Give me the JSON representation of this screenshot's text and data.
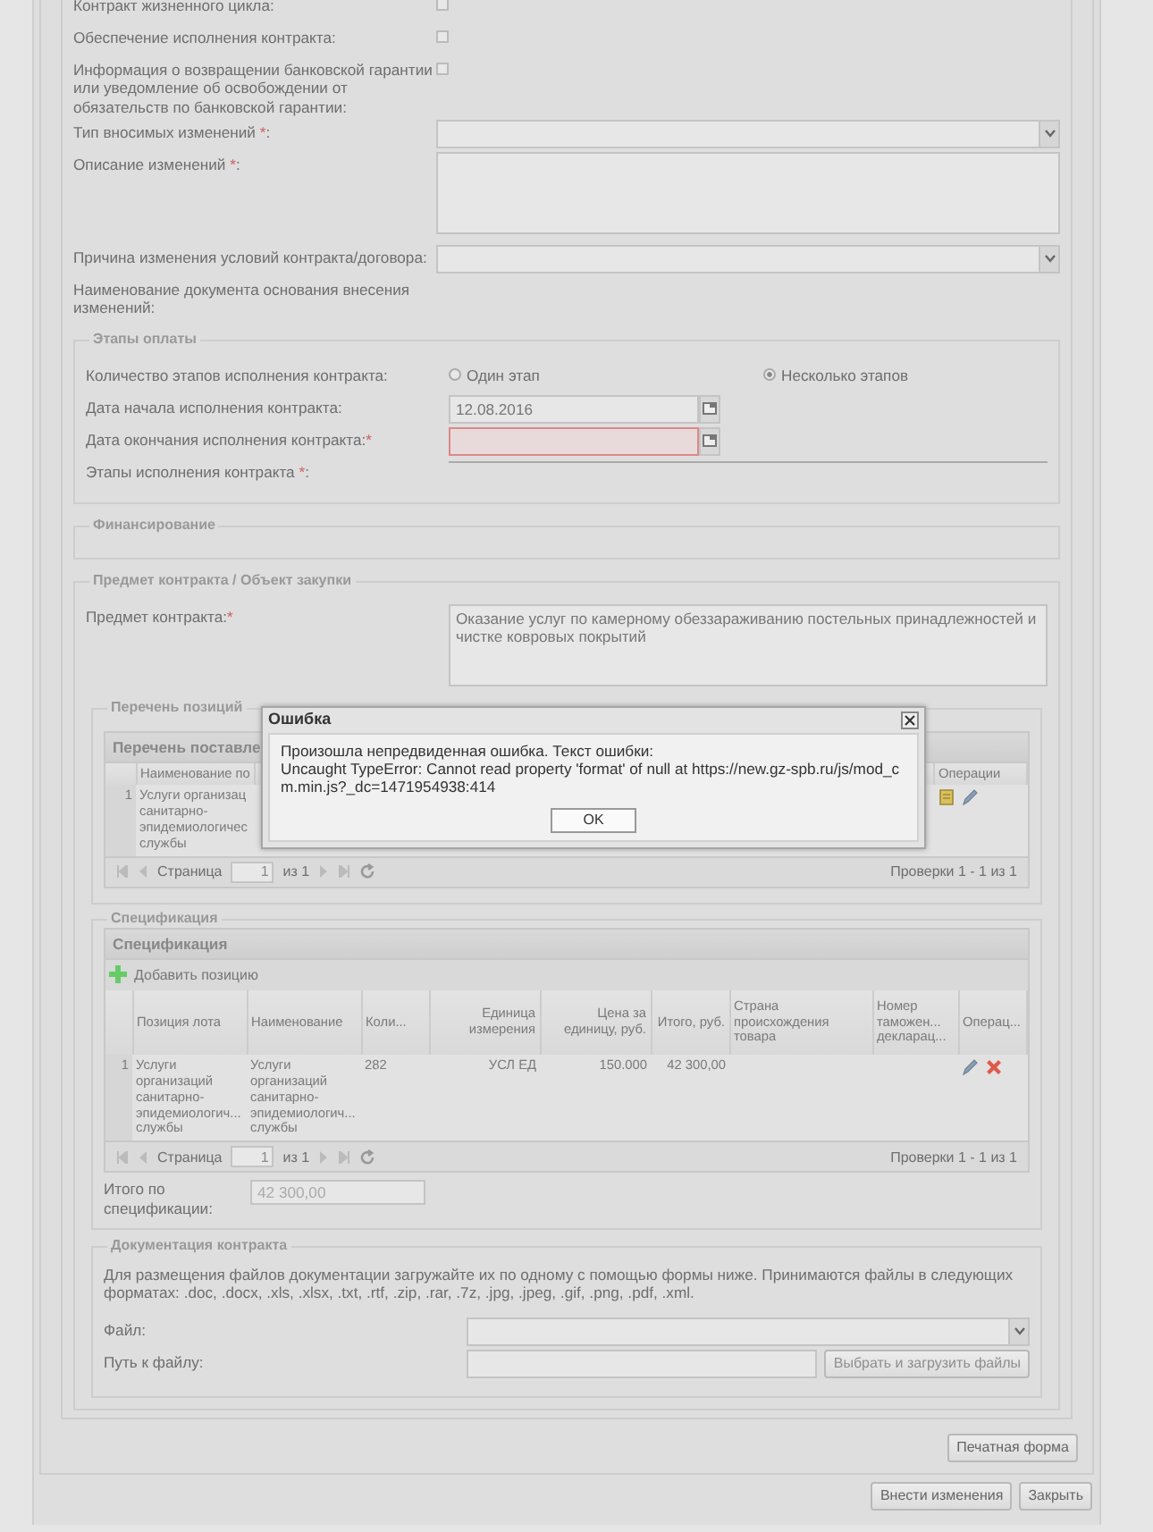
{
  "fields": [
    {
      "kind": "checkbox",
      "label": "Контракт жизненного цикла:",
      "checked": false
    },
    {
      "kind": "checkbox",
      "label": "Обеспечение исполнения контракта:",
      "checked": false
    },
    {
      "kind": "checkbox",
      "label": "Информация о возвращении банковской гарантии или уведомление об освобождении от обязательств по банковской гарантии:",
      "checked": false
    },
    {
      "kind": "select",
      "label": "Тип вносимых изменений ",
      "required_mark": "*",
      "label_end": ":"
    },
    {
      "kind": "textarea",
      "label": "Описание изменений ",
      "required_mark": "*",
      "label_end": ":"
    },
    {
      "kind": "select",
      "label": "Причина изменения условий контракта/договора:"
    },
    {
      "kind": "label",
      "label": "Наименование документа основания внесения изменений:"
    }
  ],
  "payment_stages": {
    "legend": "Этапы оплаты",
    "fields": [
      {
        "kind": "radio",
        "label": "Количество этапов исполнения контракта:",
        "options": [
          {
            "label": "Один этап",
            "selected": false
          },
          {
            "label": "Несколько этапов",
            "selected": true
          }
        ]
      },
      {
        "kind": "date",
        "label": "Дата начала исполнения контракта:",
        "value": "12.08.2016",
        "invalid": false
      },
      {
        "kind": "date",
        "label": "Дата окончания исполнения контракта:",
        "required_mark": "*",
        "invalid": true
      },
      {
        "kind": "line",
        "label": "Этапы исполнения контракта ",
        "required_mark": "*",
        "label_end": ":"
      }
    ]
  },
  "financing": {
    "legend": "Финансирование"
  },
  "subject": {
    "legend": "Предмет контракта / Объект закупки",
    "label": "Предмет контракта:",
    "required_mark": "*",
    "value": "Оказание услуг по камерному обеззараживанию постельных принадлежностей и чистке ковровых покрытий",
    "positions": {
      "legend": "Перечень позиций",
      "title": "Перечень поставле",
      "columns": [
        "Наименование по",
        "Операции"
      ],
      "rows": [
        {
          "num": "1",
          "cells": [
            "Услуги организац\nсанитарно-\nэпидемиологичес\nслужбы"
          ]
        }
      ],
      "pager": {
        "page_label": "Страница",
        "page": "1",
        "of": "из 1",
        "summary": "Проверки 1 - 1 из 1"
      }
    },
    "specification": {
      "legend": "Спецификация",
      "title": "Спецификация",
      "add_label": "Добавить позицию",
      "columns": [
        "Позиция лота",
        "Наименование",
        "Коли...",
        "Единица измерения",
        "Цена за единицу, руб.",
        "Итого, руб.",
        "Страна происхождения товара",
        "Номер таможен... декларац...",
        "Операц..."
      ],
      "rows": [
        {
          "num": "1",
          "cells": [
            "Услуги\nорганизаций\nсанитарно-\nэпидемиологич...\nслужбы",
            "Услуги\nорганизаций\nсанитарно-\nэпидемиологич...\nслужбы",
            "282",
            "УСЛ ЕД",
            "150.000",
            "42 300,00"
          ]
        }
      ],
      "pager": {
        "page_label": "Страница",
        "page": "1",
        "of": "из 1",
        "summary": "Проверки 1 - 1 из 1"
      },
      "total_label": "Итого по спецификации:",
      "total_value": "42 300,00"
    },
    "documentation": {
      "legend": "Документация контракта",
      "info": "Для размещения файлов документации загружайте их по одному с помощью формы ниже. Принимаются файлы в следующих форматах: .doc, .docx, .xls, .xlsx, .txt, .rtf, .zip, .rar, .7z, .jpg, .jpeg, .gif, .png, .pdf, .xml.",
      "file_label": "Файл:",
      "path_label": "Путь к файлу:",
      "upload_button": "Выбрать и загрузить файлы"
    }
  },
  "print_button": "Печатная форма",
  "buttons": [
    "Внести изменения",
    "Закрыть"
  ],
  "dialog": {
    "title": "Ошибка",
    "message": "Произошла непредвиденная ошибка. Текст ошибки:",
    "details": "Uncaught TypeError: Cannot read property 'format' of null at https://new.gz-spb.ru/js/mod_cm.min.js?_dc=1471954938:414",
    "button": "OK"
  }
}
